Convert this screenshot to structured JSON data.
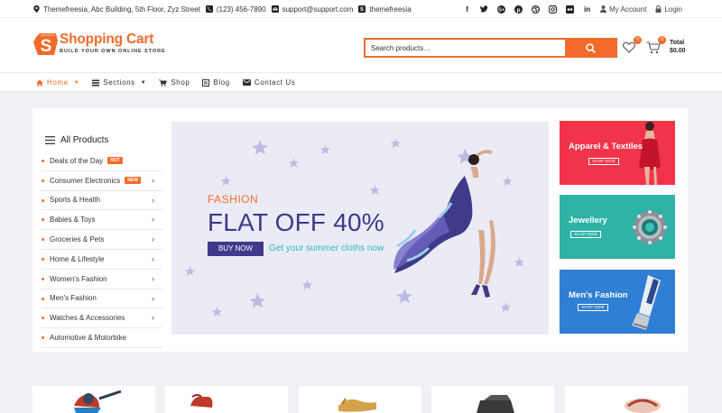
{
  "topbar": {
    "address": "Themefreesia, Abc Building, 5th Floor, Zyz Street",
    "phone": "(123) 456-7890",
    "email": "support@support.com",
    "skype": "themefreesia",
    "my_account": "My Account",
    "login": "Login",
    "social_icons": [
      "facebook-icon",
      "twitter-icon",
      "google-plus-icon",
      "pinterest-icon",
      "dribbble-icon",
      "instagram-icon",
      "flickr-icon",
      "linkedin-icon"
    ]
  },
  "header": {
    "logo_title": "Shopping Cart",
    "logo_tagline": "BUILD YOUR OWN ONLINE STORE",
    "search_placeholder": "Search products…",
    "wishlist_count": "0",
    "cart_count": "0",
    "total_label": "Total",
    "total_value": "$0.00"
  },
  "nav": {
    "items": [
      {
        "label": "Home",
        "icon": "home-icon"
      },
      {
        "label": "Sections",
        "icon": "sections-icon"
      },
      {
        "label": "Shop",
        "icon": "cart-icon"
      },
      {
        "label": "Blog",
        "icon": "blog-icon"
      },
      {
        "label": "Contact Us",
        "icon": "envelope-icon"
      }
    ]
  },
  "categories": {
    "title": "All Products",
    "items": [
      {
        "label": "Deals of the Day",
        "tag": "HOT"
      },
      {
        "label": "Consumer Electronics",
        "tag": "NEW"
      },
      {
        "label": "Sports & Health"
      },
      {
        "label": "Babies & Toys"
      },
      {
        "label": "Groceries & Pets"
      },
      {
        "label": "Home & Lifestyle"
      },
      {
        "label": "Women's Fashion"
      },
      {
        "label": "Men's Fashion"
      },
      {
        "label": "Watches & Accessories"
      },
      {
        "label": "Automotive & Motorbike"
      }
    ]
  },
  "hero": {
    "kicker": "FASHION",
    "headline": "FLAT OFF 40%",
    "button": "BUY NOW",
    "subtext": "Get your summer cloths now"
  },
  "banners": [
    {
      "title": "Apparel & Textiles",
      "button": "SHOP NOW",
      "color": "#f2344a"
    },
    {
      "title": "Jewellery",
      "button": "SHOP NOW",
      "color": "#2fb3a6"
    },
    {
      "title": "Men's Fashion",
      "button": "SHOP NOW",
      "color": "#2f7fd4"
    }
  ],
  "colors": {
    "accent": "#f26b2a",
    "hero_headline": "#3e3a8c",
    "hero_subtext": "#2dbdb6"
  }
}
